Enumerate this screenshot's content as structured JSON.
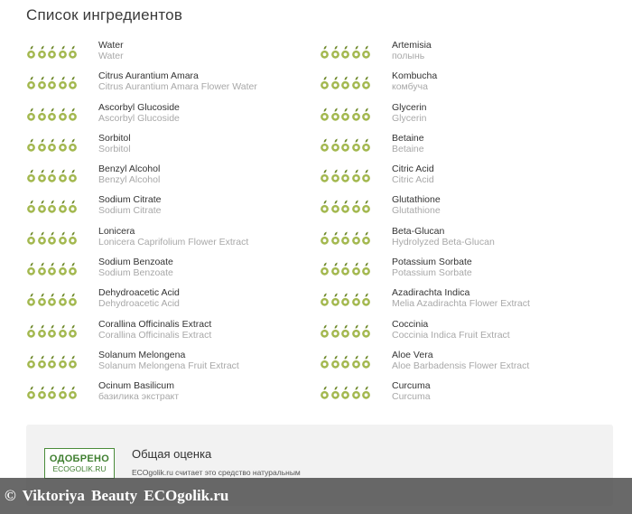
{
  "page": {
    "title": "Список ингредиентов"
  },
  "colors": {
    "drop_fill": "#a3b84f",
    "drop_dark": "#6f8a2c",
    "stamp_green": "#4a8c3a",
    "card_bg": "#f2f2f2"
  },
  "icons": {
    "rating_drop": "leaf-drop-icon"
  },
  "ingredients": {
    "left": [
      {
        "name": "Water",
        "alt": "Water",
        "rating": 5
      },
      {
        "name": "Citrus Aurantium Amara",
        "alt": "Citrus Aurantium Amara Flower Water",
        "rating": 5
      },
      {
        "name": "Ascorbyl Glucoside",
        "alt": "Ascorbyl Glucoside",
        "rating": 5
      },
      {
        "name": "Sorbitol",
        "alt": "Sorbitol",
        "rating": 5
      },
      {
        "name": "Benzyl Alcohol",
        "alt": "Benzyl Alcohol",
        "rating": 5
      },
      {
        "name": "Sodium Citrate",
        "alt": "Sodium Citrate",
        "rating": 5
      },
      {
        "name": "Lonicera",
        "alt": "Lonicera Caprifolium Flower Extract",
        "rating": 5
      },
      {
        "name": "Sodium Benzoate",
        "alt": "Sodium Benzoate",
        "rating": 5
      },
      {
        "name": "Dehydroacetic Acid",
        "alt": "Dehydroacetic Acid",
        "rating": 5
      },
      {
        "name": "Corallina Officinalis Extract",
        "alt": "Corallina Officinalis Extract",
        "rating": 5
      },
      {
        "name": "Solanum Melongena",
        "alt": "Solanum Melongena Fruit Extract",
        "rating": 5
      },
      {
        "name": "Ocinum Basilicum",
        "alt": "базилика экстракт",
        "rating": 5
      }
    ],
    "right": [
      {
        "name": "Artemisia",
        "alt": "полынь",
        "rating": 5
      },
      {
        "name": "Kombucha",
        "alt": "комбуча",
        "rating": 5
      },
      {
        "name": "Glycerin",
        "alt": "Glycerin",
        "rating": 5
      },
      {
        "name": "Betaine",
        "alt": "Betaine",
        "rating": 5
      },
      {
        "name": "Citric Acid",
        "alt": "Citric Acid",
        "rating": 5
      },
      {
        "name": "Glutathione",
        "alt": "Glutathione",
        "rating": 5
      },
      {
        "name": "Beta-Glucan",
        "alt": "Hydrolyzed Beta-Glucan",
        "rating": 5
      },
      {
        "name": "Potassium Sorbate",
        "alt": "Potassium Sorbate",
        "rating": 5
      },
      {
        "name": "Azadirachta Indica",
        "alt": "Melia Azadirachta Flower Extract",
        "rating": 5
      },
      {
        "name": "Coccinia",
        "alt": "Coccinia Indica Fruit Extract",
        "rating": 5
      },
      {
        "name": "Aloe Vera",
        "alt": "Aloe Barbadensis Flower Extract",
        "rating": 5
      },
      {
        "name": "Curcuma",
        "alt": "Curcuma",
        "rating": 5
      }
    ]
  },
  "summary": {
    "stamp_top": "ОДОБРЕНО",
    "stamp_bottom": "ECOGOLIK.RU",
    "title": "Общая оценка",
    "text": "ECOgolik.ru считает это средство натуральным"
  },
  "watermark": {
    "text": "© Viktoriya Beauty ECOgolik.ru"
  }
}
